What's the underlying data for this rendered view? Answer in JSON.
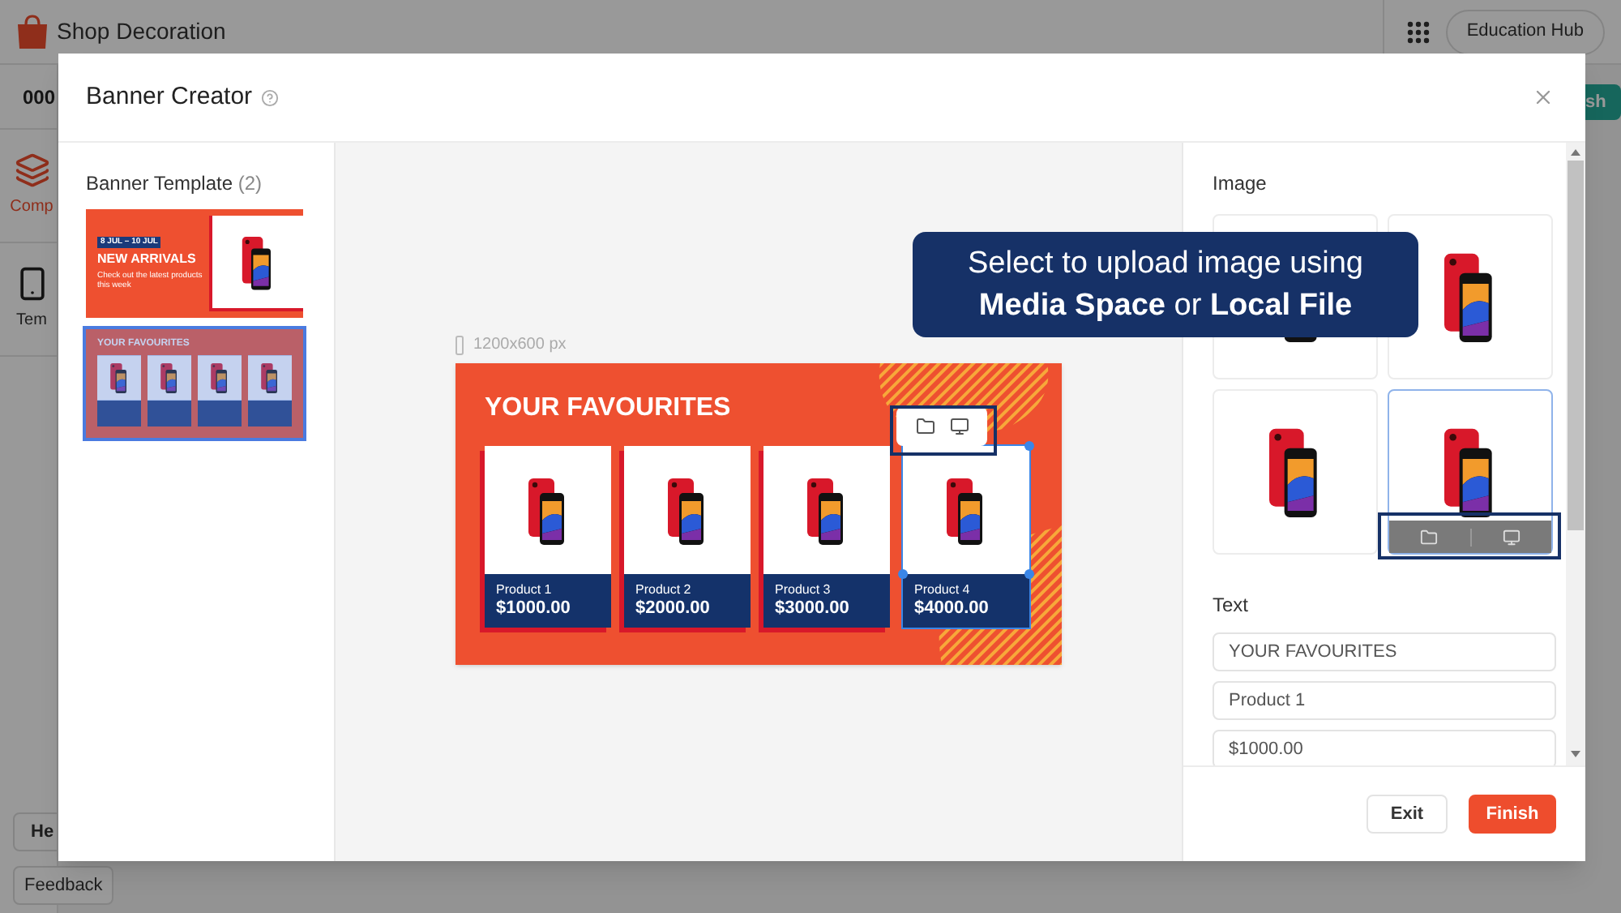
{
  "app": {
    "title": "Shop Decoration",
    "education_hub": "Education Hub"
  },
  "background": {
    "shop_id": "000",
    "nav_items": [
      {
        "label": "Comp",
        "kind": "layers",
        "selected": true
      },
      {
        "label": "Tem",
        "kind": "template",
        "selected": false
      }
    ],
    "help_button": "He",
    "feedback_button": "Feedback",
    "publish_button": "sh"
  },
  "modal": {
    "title": "Banner Creator"
  },
  "templates": {
    "heading": "Banner Template",
    "count": "(2)",
    "items": [
      {
        "kind": "new_arrivals",
        "selected": false,
        "date": "8 JUL – 10 JUL",
        "title": "NEW ARRIVALS",
        "subtitle": "Check out the latest products this week"
      },
      {
        "kind": "favourites",
        "selected": true,
        "title": "YOUR FAVOURITES"
      }
    ]
  },
  "canvas": {
    "size": "1200x600 px",
    "banner": {
      "title": "YOUR FAVOURITES",
      "products": [
        {
          "name": "Product 1",
          "price": "$1000.00",
          "selected": false
        },
        {
          "name": "Product 2",
          "price": "$2000.00",
          "selected": false
        },
        {
          "name": "Product 3",
          "price": "$3000.00",
          "selected": false
        },
        {
          "name": "Product 4",
          "price": "$4000.00",
          "selected": true
        }
      ]
    }
  },
  "tooltip": {
    "lines": [
      "Select to upload image using",
      "**Media Space** or **Local File**"
    ]
  },
  "image_panel": {
    "heading": "Image",
    "tiles": [
      {
        "selected": false
      },
      {
        "selected": false
      },
      {
        "selected": false
      },
      {
        "selected": true
      }
    ]
  },
  "text_panel": {
    "heading": "Text",
    "fields": [
      {
        "value": "YOUR FAVOURITES"
      },
      {
        "value": "Product 1"
      },
      {
        "value": "$1000.00"
      }
    ]
  },
  "footer": {
    "buttons": [
      {
        "label": "Exit",
        "kind": "secondary"
      },
      {
        "label": "Finish",
        "kind": "primary"
      }
    ]
  }
}
